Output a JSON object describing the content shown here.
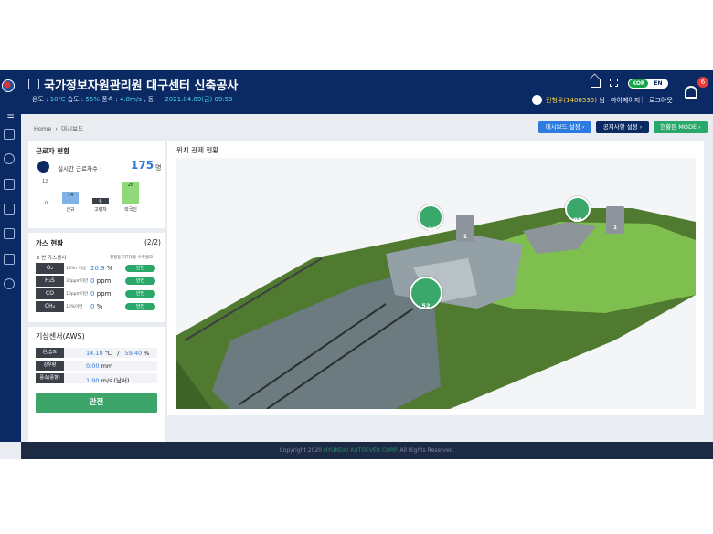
{
  "header": {
    "title": "국가정보자원관리원 대구센터 신축공사",
    "weather": {
      "temp_label": "온도 :",
      "temp_value": "10℃",
      "humidity_label": "습도 :",
      "humidity_value": "55%",
      "wind_label": "풍속 :",
      "wind_value": "4.8m/s",
      "wind_dir": ", 동",
      "datetime": "2021.04.09(금) 09:59"
    },
    "lang": {
      "kor": "KOR",
      "en": "EN"
    },
    "notification_count": "6",
    "user": {
      "name": "전형우(1406535)",
      "suffix": " 님"
    },
    "mypage": "마이페이지",
    "logout": "로그아웃",
    "separator": "|"
  },
  "breadcrumb": {
    "home": "Home",
    "current": "대시보드"
  },
  "top_buttons": {
    "dashboard_settings": "대시보드 설정 ›",
    "notice_settings": "공지사항 설정 ›",
    "status_mode": "현황판 MODE ›"
  },
  "workers": {
    "title": "근로자 현황",
    "realtime_label": "실시간 근로자수 :",
    "realtime_value": "175",
    "realtime_unit": "명",
    "axis_max": "12",
    "axis_min": "0",
    "bars": [
      {
        "label": "신규",
        "value": 14,
        "color": "#7fb3e8"
      },
      {
        "label": "고령자",
        "value": 6,
        "color": "#3b3f47"
      },
      {
        "label": "외국인",
        "value": 26,
        "color": "#8fd97a"
      }
    ]
  },
  "gas": {
    "title": "가스 현황",
    "page": "(2/2)",
    "sensor": "2 번 가스센서",
    "location": "행정동 지하1층 수화탱크",
    "rows": [
      {
        "name": "O₂",
        "threshold": "18%↑이상",
        "value": "20.9",
        "unit": "%",
        "status": "안전"
      },
      {
        "name": "H₂S",
        "threshold": "30ppm미만",
        "value": "0",
        "unit": "ppm",
        "status": "안전"
      },
      {
        "name": "CO",
        "threshold": "10ppm미만",
        "value": "0",
        "unit": "ppm",
        "status": "안전"
      },
      {
        "name": "CH₄",
        "threshold": "10%미만",
        "value": "0",
        "unit": "%",
        "status": "안전"
      }
    ]
  },
  "aws": {
    "title": "기상센서(AWS)",
    "rows": [
      {
        "name": "온/습도",
        "v1": "14.10",
        "u1": "℃",
        "slash": "/",
        "v2": "59.40",
        "u2": "%"
      },
      {
        "name": "강우량",
        "v1": "0.00",
        "u1": "mm"
      },
      {
        "name": "풍속(풍향)",
        "v1": "1.90",
        "u1": "m/s (남서)"
      }
    ],
    "status_button": "안전"
  },
  "map": {
    "title": "위치 관제 현황",
    "worker_pins": [
      "23",
      "52",
      "98"
    ],
    "sensor_pins": [
      "1",
      "1"
    ]
  },
  "footer": {
    "prefix": "Copyright 2020 ",
    "brand": "HYUNDAI AUTOEVER CORP.",
    "suffix": " All Rights Reserved."
  }
}
